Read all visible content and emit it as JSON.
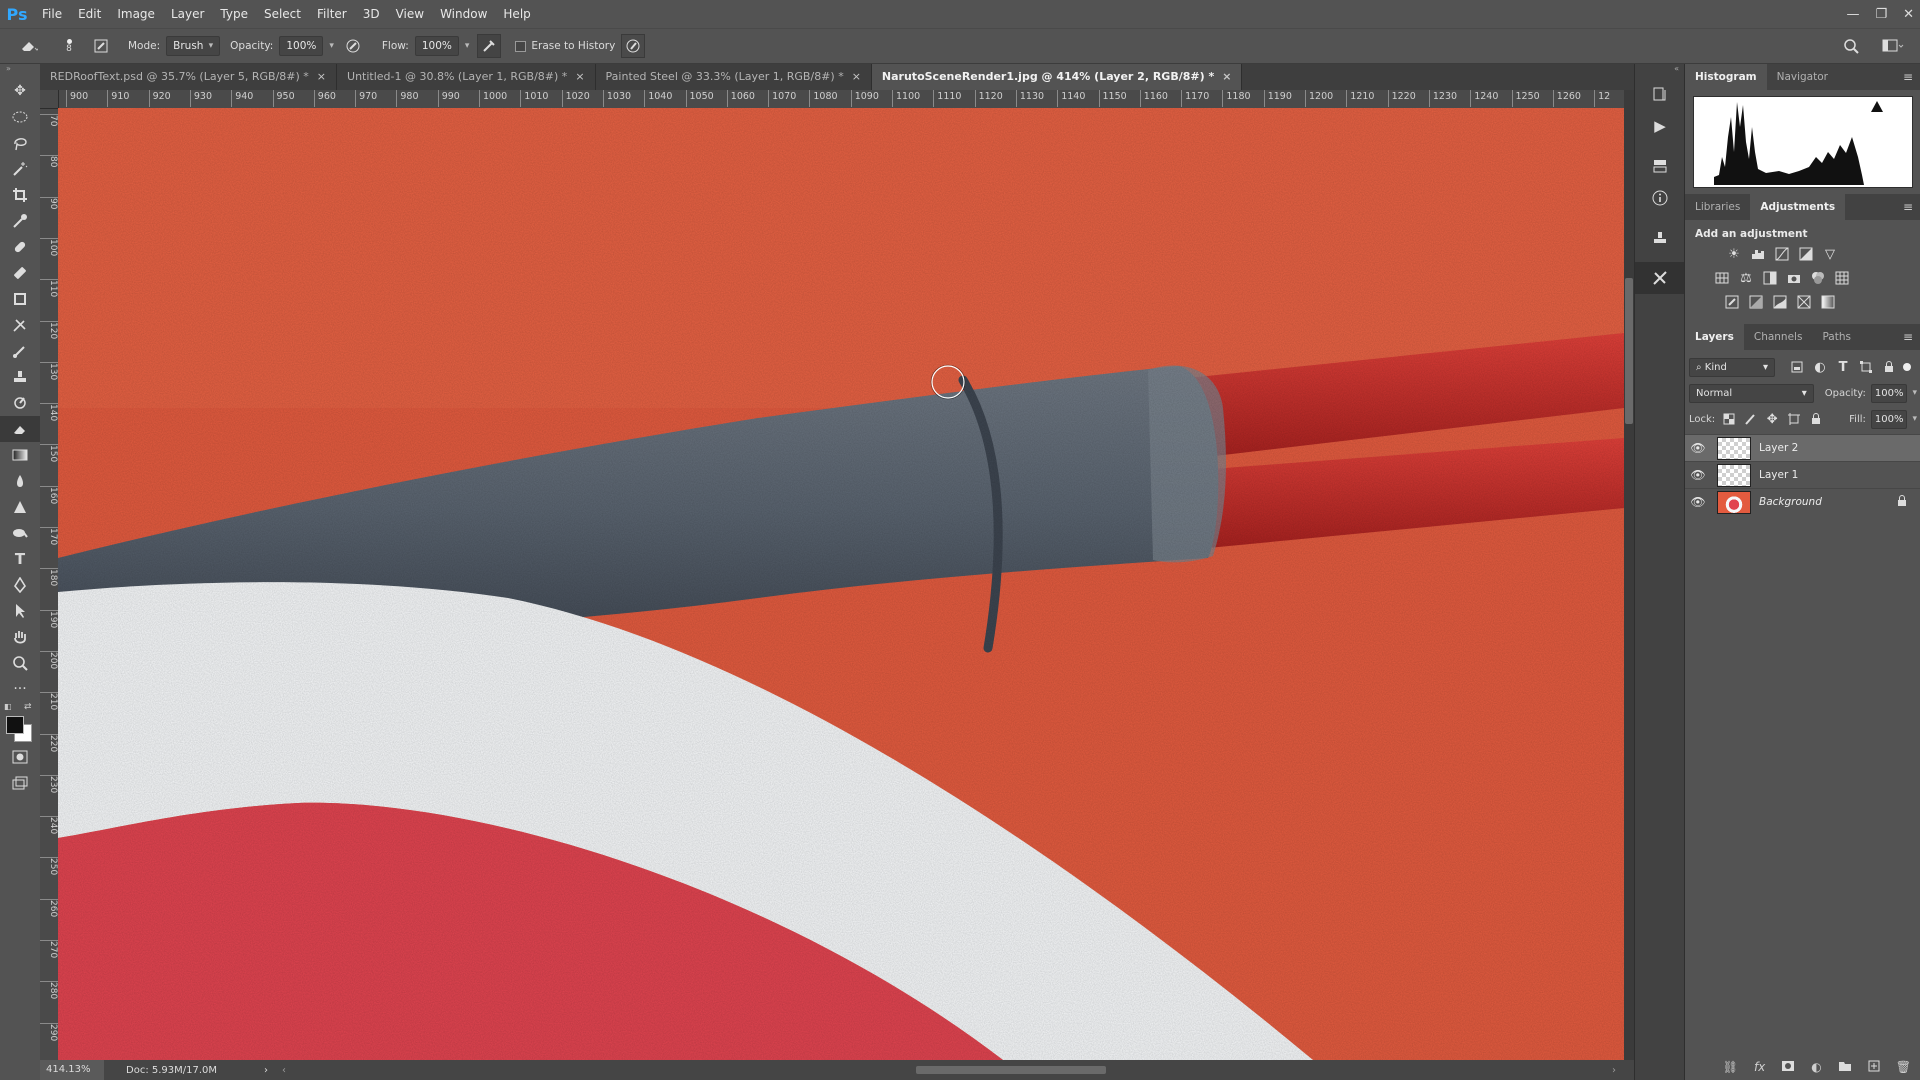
{
  "app": {
    "logo": "Ps",
    "window_controls": [
      "—",
      "❐",
      "✕"
    ]
  },
  "menu": [
    "File",
    "Edit",
    "Image",
    "Layer",
    "Type",
    "Select",
    "Filter",
    "3D",
    "View",
    "Window",
    "Help"
  ],
  "options": {
    "brush_size": "8",
    "mode_label": "Mode:",
    "mode_value": "Brush",
    "opacity_label": "Opacity:",
    "opacity_value": "100%",
    "flow_label": "Flow:",
    "flow_value": "100%",
    "erase_history_label": "Erase to History"
  },
  "tabs": [
    {
      "label": "REDRoofText.psd @ 35.7% (Layer 5, RGB/8#) *",
      "close": "×"
    },
    {
      "label": "Untitled-1 @ 30.8% (Layer 1, RGB/8#) *",
      "close": "×"
    },
    {
      "label": "Painted Steel @ 33.3% (Layer 1, RGB/8#) *",
      "close": "×"
    },
    {
      "label": "NarutoSceneRender1.jpg @ 414% (Layer 2, RGB/8#) *",
      "close": "×"
    }
  ],
  "ruler_top": [
    "900",
    "910",
    "920",
    "930",
    "940",
    "950",
    "960",
    "970",
    "980",
    "990",
    "1000",
    "1010",
    "1020",
    "1030",
    "1040",
    "1050",
    "1060",
    "1070",
    "1080",
    "1090",
    "1100",
    "1110",
    "1120",
    "1130",
    "1140",
    "1150",
    "1160",
    "1170",
    "1180",
    "1190",
    "1200",
    "1210",
    "1220",
    "1230",
    "1240",
    "1250",
    "1260",
    "12"
  ],
  "ruler_left": [
    "70",
    "80",
    "90",
    "100",
    "110",
    "120",
    "130",
    "140",
    "150",
    "160",
    "170",
    "180",
    "190",
    "200",
    "210",
    "220",
    "230",
    "240",
    "250",
    "260",
    "270",
    "280",
    "290"
  ],
  "status": {
    "zoom": "414.13%",
    "doc": "Doc: 5.93M/17.0M",
    "arrow": "›"
  },
  "panels": {
    "histogram_tabs": [
      "Histogram",
      "Navigator"
    ],
    "adjust_tabs": [
      "Libraries",
      "Adjustments"
    ],
    "add_adjustment": "Add an adjustment",
    "layers_tabs": [
      "Layers",
      "Channels",
      "Paths"
    ],
    "kind_label": "Kind",
    "blend_mode": "Normal",
    "opacity_label": "Opacity:",
    "opacity_value": "100%",
    "lock_label": "Lock:",
    "fill_label": "Fill:",
    "fill_value": "100%"
  },
  "layers": [
    {
      "name": "Layer 2",
      "selected": true
    },
    {
      "name": "Layer 1",
      "selected": false
    },
    {
      "name": "Background",
      "selected": false,
      "locked": true
    }
  ],
  "colors": {
    "canvas_red": "#e45a3e",
    "pipe_gray": "#5b6572",
    "wire_red": "#d82e2c",
    "ring_white": "#f6f8fa",
    "inner_red": "#e14450"
  }
}
